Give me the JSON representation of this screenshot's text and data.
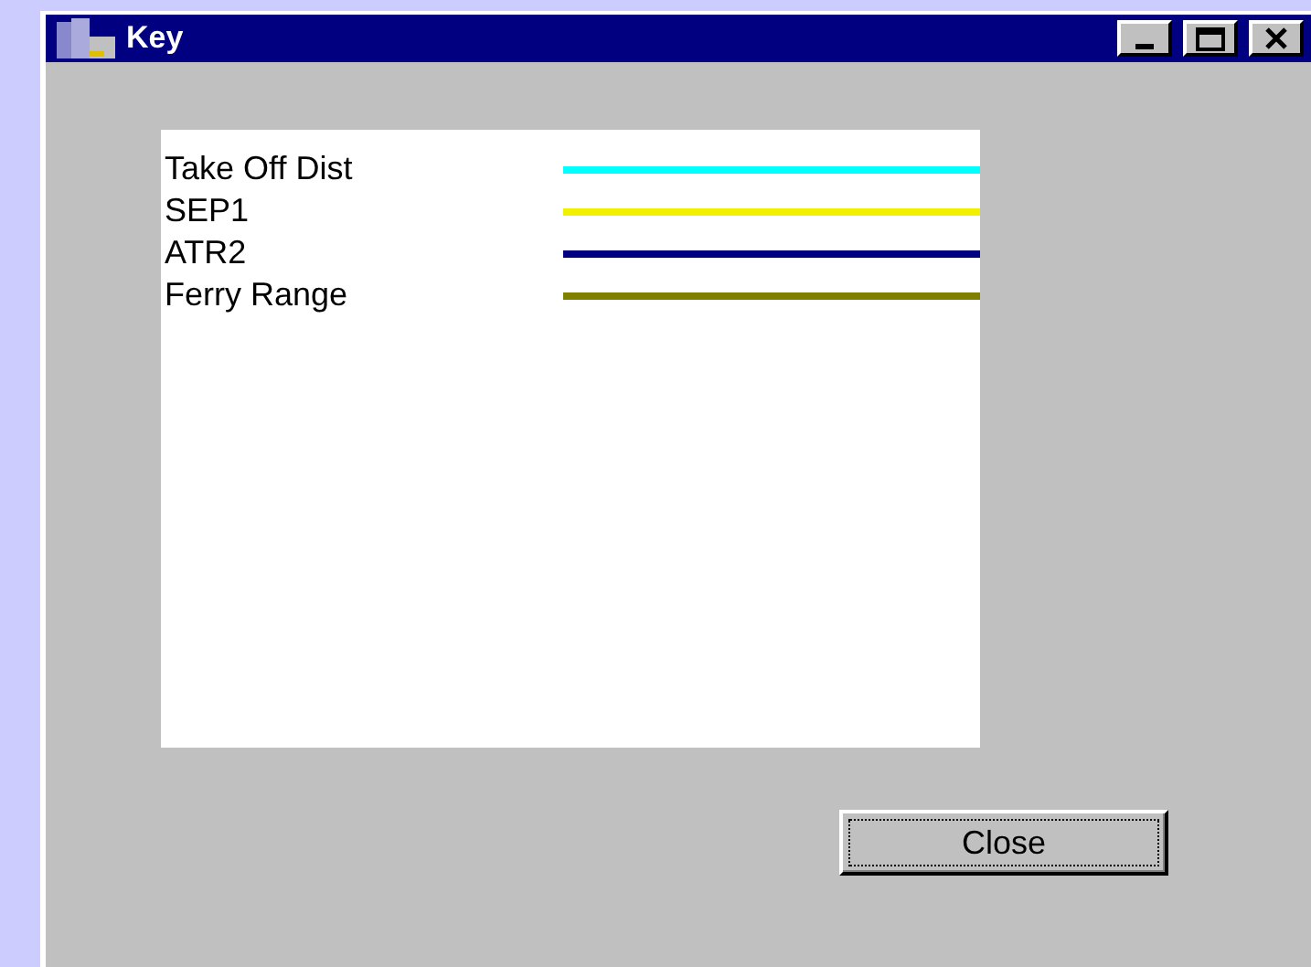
{
  "window": {
    "title": "Key"
  },
  "legend": [
    {
      "label": "Take Off Dist",
      "color": "#00ffff"
    },
    {
      "label": "SEP1",
      "color": "#f0f000"
    },
    {
      "label": "ATR2",
      "color": "#000080"
    },
    {
      "label": "Ferry Range",
      "color": "#808000"
    }
  ],
  "buttons": [
    {
      "label": "Close"
    }
  ]
}
